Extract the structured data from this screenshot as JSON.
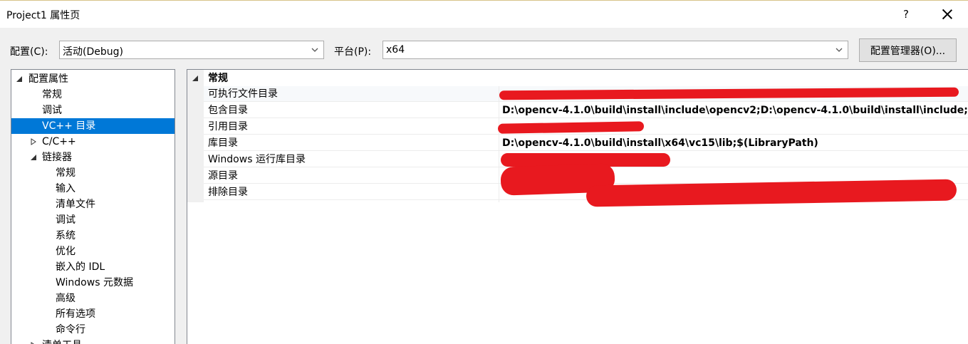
{
  "window": {
    "title": "Project1 属性页",
    "help_label": "?",
    "close_icon": "close-icon"
  },
  "config_bar": {
    "config_label": "配置(C):",
    "config_value": "活动(Debug)",
    "platform_label": "平台(P):",
    "platform_value": "x64",
    "manager_button": "配置管理器(O)..."
  },
  "tree": {
    "items": [
      {
        "label": "配置属性",
        "expander": "expanded"
      },
      {
        "label": "常规"
      },
      {
        "label": "调试"
      },
      {
        "label": "VC++ 目录",
        "selected": true
      },
      {
        "label": "C/C++",
        "expander": "collapsed"
      },
      {
        "label": "链接器",
        "expander": "expanded"
      },
      {
        "label": "常规"
      },
      {
        "label": "输入"
      },
      {
        "label": "清单文件"
      },
      {
        "label": "调试"
      },
      {
        "label": "系统"
      },
      {
        "label": "优化"
      },
      {
        "label": "嵌入的 IDL"
      },
      {
        "label": "Windows 元数据"
      },
      {
        "label": "高级"
      },
      {
        "label": "所有选项"
      },
      {
        "label": "命令行"
      },
      {
        "label": "清单工具",
        "expander": "collapsed"
      }
    ]
  },
  "grid": {
    "category": "常规",
    "rows": [
      {
        "name": "可执行文件目录",
        "value": ""
      },
      {
        "name": "包含目录",
        "value": "D:\\opencv-4.1.0\\build\\install\\include\\opencv2;D:\\opencv-4.1.0\\build\\install\\include;$"
      },
      {
        "name": "引用目录",
        "value": ""
      },
      {
        "name": "库目录",
        "value": "D:\\opencv-4.1.0\\build\\install\\x64\\vc15\\lib;$(LibraryPath)"
      },
      {
        "name": "Windows 运行库目录",
        "value": ""
      },
      {
        "name": "源目录",
        "value": ""
      },
      {
        "name": "排除目录",
        "value": ""
      }
    ]
  },
  "colors": {
    "selection": "#0078d7",
    "redaction": "#e8191f"
  }
}
